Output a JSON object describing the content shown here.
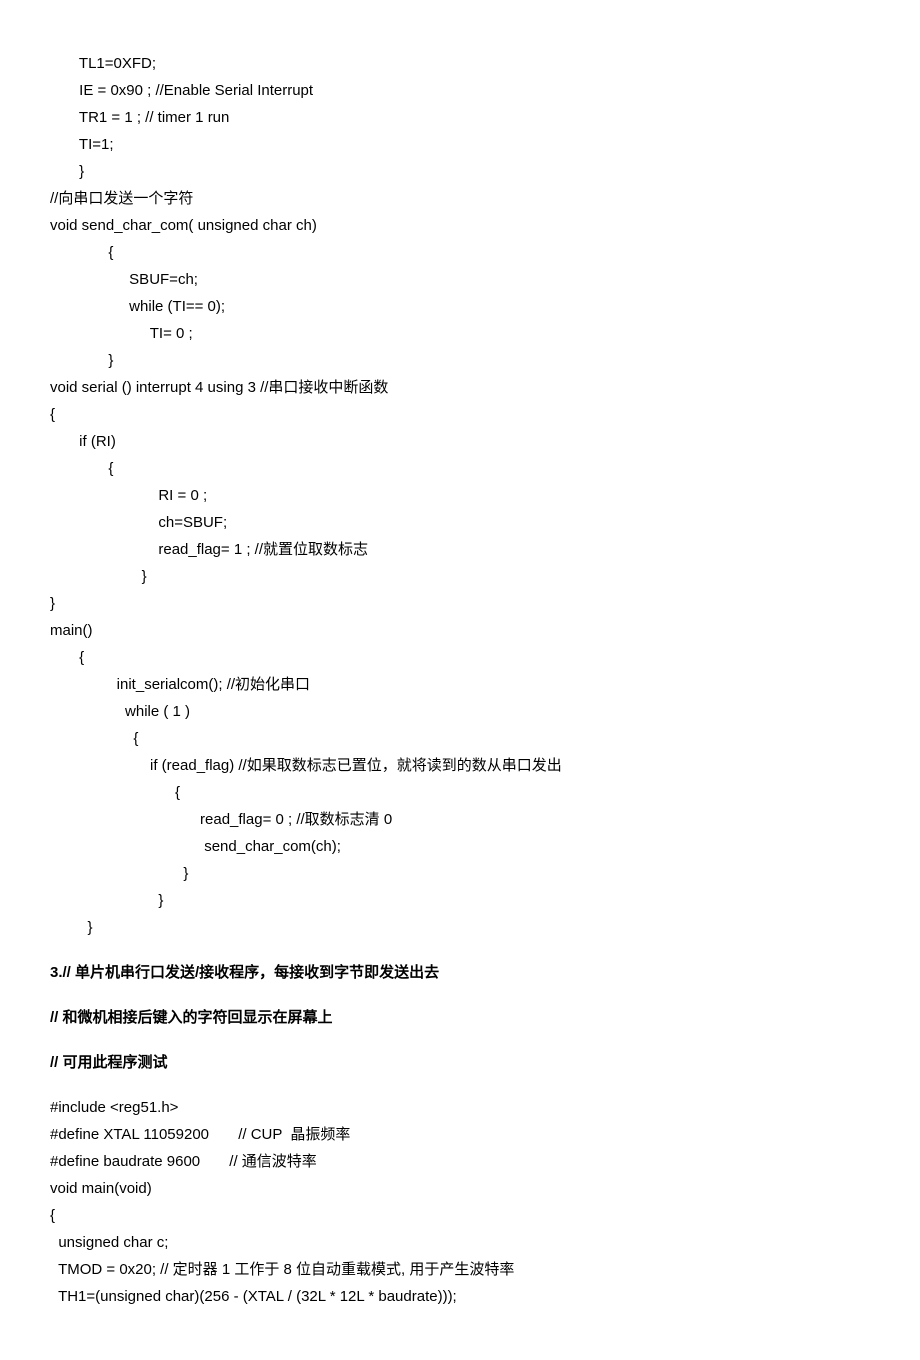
{
  "code1": [
    "       TL1=0XFD;",
    "       IE = 0x90 ; //Enable Serial Interrupt",
    "       TR1 = 1 ; // timer 1 run",
    "       TI=1;",
    "       }",
    "//向串口发送一个字符",
    "void send_char_com( unsigned char ch)",
    "              {",
    "                   SBUF=ch;",
    "                   while (TI== 0);",
    "                        TI= 0 ;",
    "              }",
    "void serial () interrupt 4 using 3 //串口接收中断函数",
    "{",
    "       if (RI)",
    "              {",
    "                          RI = 0 ;",
    "                          ch=SBUF;",
    "                          read_flag= 1 ; //就置位取数标志",
    "                      }",
    "}",
    "main()",
    "       {",
    "                init_serialcom(); //初始化串口",
    "                  while ( 1 )",
    "                    {",
    "                        if (read_flag) //如果取数标志已置位，就将读到的数从串口发出",
    "                              {",
    "                                    read_flag= 0 ; //取数标志清 0",
    "                                     send_char_com(ch);",
    "                                }",
    "                          }",
    "         }"
  ],
  "heading3": "3.// 单片机串行口发送/接收程序，每接收到字节即发送出去",
  "heading4": "// 和微机相接后键入的字符回显示在屏幕上",
  "heading5": "// 可用此程序测试",
  "code2": [
    "#include <reg51.h>",
    "#define XTAL 11059200       // CUP  晶振频率",
    "#define baudrate 9600       // 通信波特率",
    "void main(void)",
    "{",
    "  unsigned char c;",
    "  TMOD = 0x20; // 定时器 1 工作于 8 位自动重载模式, 用于产生波特率",
    "  TH1=(unsigned char)(256 - (XTAL / (32L * 12L * baudrate)));"
  ]
}
